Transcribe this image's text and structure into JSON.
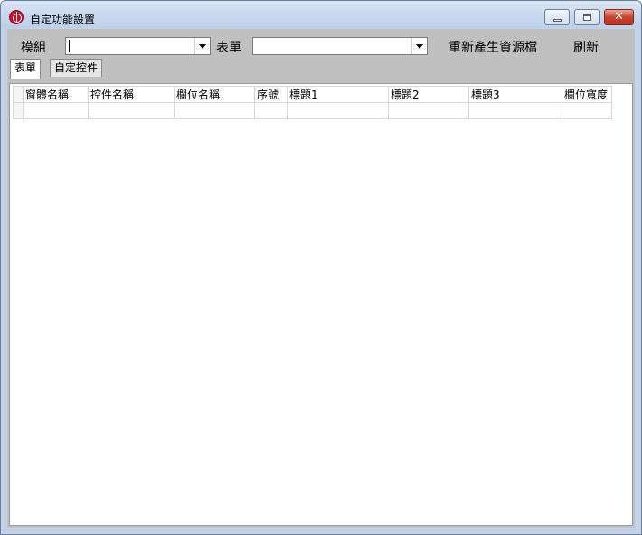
{
  "window": {
    "title": "自定功能設置",
    "icons": {
      "app": "app-icon",
      "minimize": "minimize-icon",
      "maximize": "maximize-icon",
      "close": "close-icon"
    },
    "close_glyph": "✕"
  },
  "toolbar": {
    "module_label": "模組",
    "module_value": "",
    "form_label": "表單",
    "form_value": "",
    "regen_button": "重新產生資源檔",
    "refresh_button": "刷新"
  },
  "tabs": [
    {
      "label": "表單",
      "active": true
    },
    {
      "label": "自定控件",
      "active": false
    }
  ],
  "grid": {
    "columns": [
      "窗體名稱",
      "控件名稱",
      "欄位名稱",
      "序號",
      "標題1",
      "標題2",
      "標題3",
      "欄位寬度"
    ],
    "rows": [
      [
        "",
        "",
        "",
        "",
        "",
        "",
        "",
        ""
      ]
    ]
  }
}
